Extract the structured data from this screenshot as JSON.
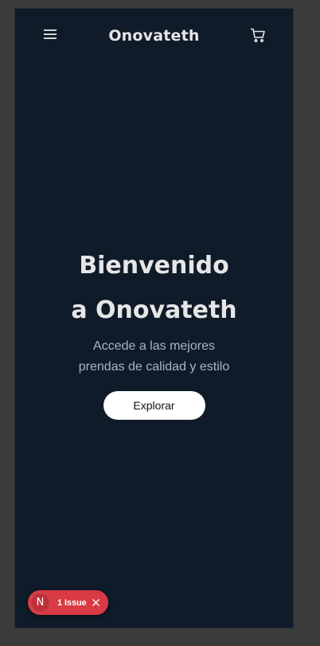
{
  "header": {
    "brand": "Onovateth",
    "menu_icon": "hamburger-menu-icon",
    "cart_icon": "shopping-cart-icon"
  },
  "hero": {
    "title_line1": "Bienvenido",
    "title_line2": "a Onovateth",
    "subtitle_line1": "Accede a las mejores",
    "subtitle_line2": "prendas de calidad y estilo",
    "cta_label": "Explorar"
  },
  "dev_overlay": {
    "logo_letter": "N",
    "issues_label": "1 Issue",
    "close_icon": "close-icon"
  },
  "colors": {
    "background": "#0f1b29",
    "text_primary": "#e6e6e6",
    "text_secondary": "#a8b5c6",
    "button_bg": "#ffffff",
    "issue_badge": "#d93a43"
  }
}
